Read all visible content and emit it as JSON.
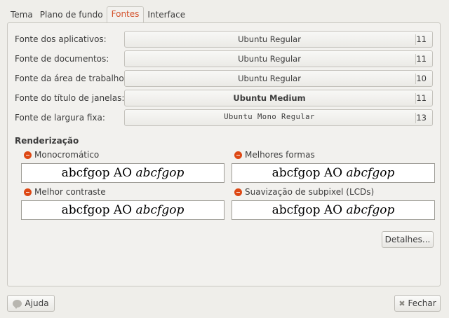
{
  "tabs": [
    {
      "label": "Tema"
    },
    {
      "label": "Plano de fundo"
    },
    {
      "label": "Fontes"
    },
    {
      "label": "Interface"
    }
  ],
  "active_tab": "Fontes",
  "fonts": [
    {
      "label": "Fonte dos aplicativos:",
      "font": "Ubuntu Regular",
      "size": "11"
    },
    {
      "label": "Fonte de documentos:",
      "font": "Ubuntu Regular",
      "size": "11"
    },
    {
      "label": "Fonte da área de trabalho:",
      "font": "Ubuntu Regular",
      "size": "10"
    },
    {
      "label": "Fonte do título de janelas:",
      "font": "Ubuntu Medium",
      "size": "11"
    },
    {
      "label": "Fonte de largura fixa:",
      "font": "Ubuntu Mono Regular",
      "size": "13"
    }
  ],
  "rendering": {
    "title": "Renderização",
    "options": [
      {
        "label": "Monocromático",
        "sample_regular": "abcfgop AO ",
        "sample_italic": "abcfgop"
      },
      {
        "label": "Melhores formas",
        "sample_regular": "abcfgop AO ",
        "sample_italic": "abcfgop"
      },
      {
        "label": "Melhor contraste",
        "sample_regular": "abcfgop AO ",
        "sample_italic": "abcfgop"
      },
      {
        "label": "Suavização de subpixel (LCDs)",
        "sample_regular": "abcfgop AO ",
        "sample_italic": "abcfgop"
      }
    ]
  },
  "details_label": "Detalhes...",
  "help_label": "Ajuda",
  "close_label": "Fechar",
  "colors": {
    "accent": "#dd4814",
    "active_tab_text": "#d4522c"
  }
}
